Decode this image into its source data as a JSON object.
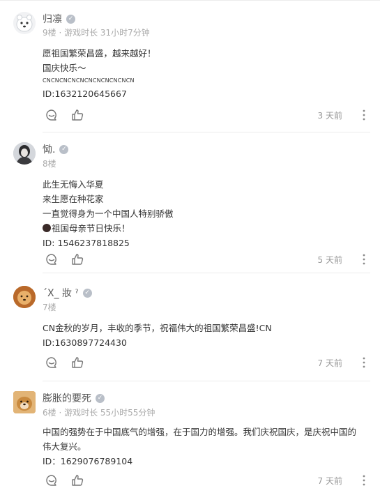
{
  "comments": [
    {
      "username": "归凛",
      "meta": "9楼 · 游戏时长 31小时7分钟",
      "lines": [
        "愿祖国繁荣昌盛，越来越好！",
        "国庆快乐～"
      ],
      "small_line": "CNCNCNCNCNCNCNCNCNCNCN",
      "id_line": "ID:1632120645667",
      "time": "3 天前"
    },
    {
      "username": "恸.",
      "meta": "8楼",
      "lines": [
        "此生无悔入华夏",
        "来生愿在种花家",
        "一直觉得身为一个中国人特别骄傲"
      ],
      "emoji_line": "祖国母亲节日快乐！",
      "id_line": "ID: 1546237818825",
      "time": "5 天前"
    },
    {
      "username": "ˊX_ 妝 ˀ",
      "meta": "7楼",
      "lines": [
        "CN金秋的岁月，丰收的季节，祝福伟大的祖国繁荣昌盛!CN"
      ],
      "id_line": "ID:1630897724430",
      "time": "7 天前"
    },
    {
      "username": "膨胀的要死",
      "meta": "6楼 · 游戏时长 55小时55分钟",
      "lines": [
        "中国的强势在于中国底气的增强，在于国力的增强。我们庆祝国庆，是庆祝中国的",
        "伟大复兴。"
      ],
      "id_line": "ID：1629076789104",
      "time": "7 天前"
    }
  ],
  "icons": {
    "reply": "comment-bubble-icon",
    "like": "thumbs-up-icon",
    "more": "more-vertical-icon",
    "badge": "verified-badge-icon"
  }
}
